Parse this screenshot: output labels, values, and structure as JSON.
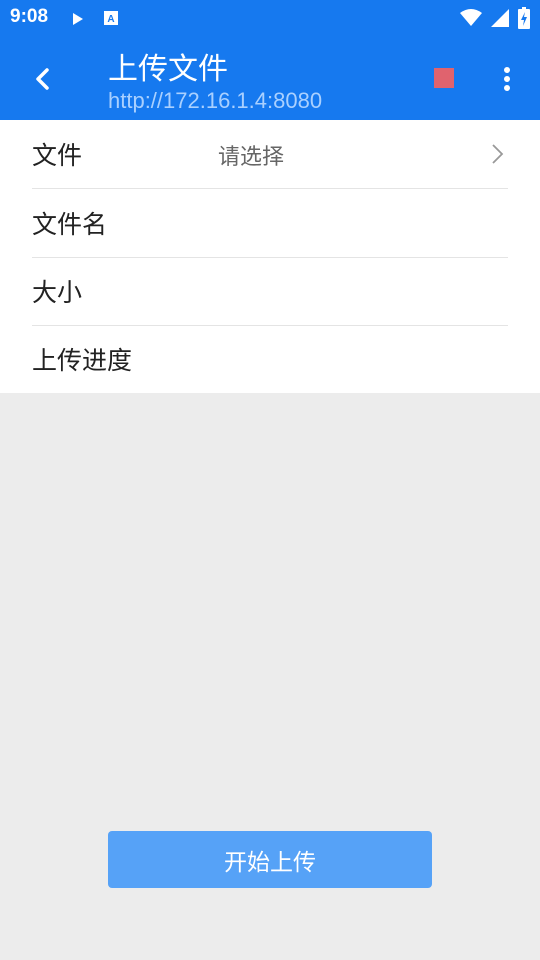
{
  "status_bar": {
    "time": "9:08",
    "icons": [
      "play-icon",
      "a-notification-icon",
      "wifi-icon",
      "cell-signal-icon",
      "battery-charging-icon"
    ]
  },
  "app_bar": {
    "title": "上传文件",
    "subtitle": "http://172.16.1.4:8080",
    "back_icon": "back-arrow-icon",
    "stop_icon": "stop-icon",
    "stop_color": "#e0636e",
    "more_icon": "more-vert-icon",
    "background_color": "#1679ef"
  },
  "form": {
    "rows": [
      {
        "label": "文件",
        "value": "请选择"
      },
      {
        "label": "文件名",
        "value": ""
      },
      {
        "label": "大小",
        "value": ""
      },
      {
        "label": "上传进度",
        "value": ""
      }
    ]
  },
  "actions": {
    "upload_label": "开始上传",
    "upload_color": "#56a2f7"
  }
}
